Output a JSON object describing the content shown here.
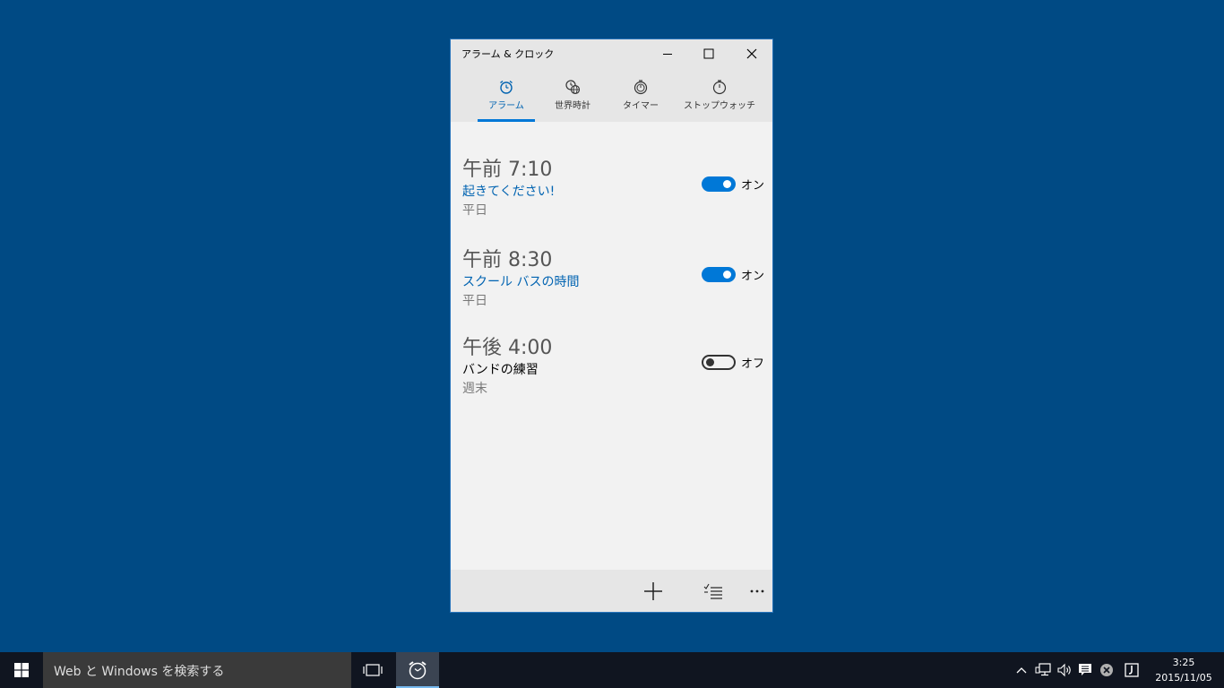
{
  "window": {
    "title": "アラーム & クロック"
  },
  "tabs": [
    {
      "label": "アラーム",
      "icon": "alarm-clock-icon",
      "active": true
    },
    {
      "label": "世界時計",
      "icon": "world-clock-icon",
      "active": false
    },
    {
      "label": "タイマー",
      "icon": "timer-icon",
      "active": false
    },
    {
      "label": "ストップウォッチ",
      "icon": "stopwatch-icon",
      "active": false
    }
  ],
  "alarms": [
    {
      "time": "午前 7:10",
      "name": "起きてください!",
      "days": "平日",
      "state": "オン",
      "enabled": true
    },
    {
      "time": "午前 8:30",
      "name": "スクール バスの時間",
      "days": "平日",
      "state": "オン",
      "enabled": true
    },
    {
      "time": "午後 4:00",
      "name": "バンドの練習",
      "days": "週末",
      "state": "オフ",
      "enabled": false
    }
  ],
  "commandbar": {
    "icons": [
      "add-icon",
      "select-list-icon",
      "more-icon"
    ]
  },
  "taskbar": {
    "search_placeholder": "Web と Windows を検索する",
    "time": "3:25",
    "date": "2015/11/05"
  },
  "colors": {
    "accent": "#0078d7",
    "desktop": "#004a84",
    "taskbar": "#101520"
  }
}
